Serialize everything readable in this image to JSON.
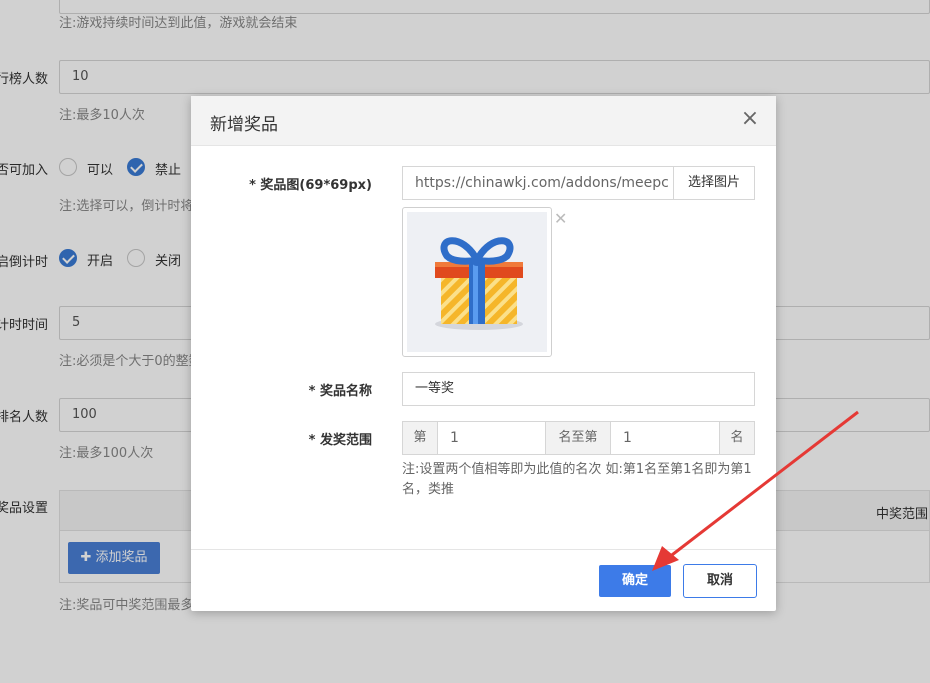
{
  "background_form": {
    "game_duration_hint": "注:游戏持续时间达到此值，游戏就会结束",
    "leaderboard_label": "行榜人数",
    "leaderboard_value": "10",
    "leaderboard_hint": "注:最多10人次",
    "join_label": "否可加入",
    "join_options": [
      "可以",
      "禁止"
    ],
    "join_hint": "注:选择可以，倒计时将",
    "countdown_label": "启倒计时",
    "countdown_options": [
      "开启",
      "关闭"
    ],
    "countdown_time_label": "计时时间",
    "countdown_time_value": "5",
    "countdown_time_hint": "注:必须是个大于0的整数",
    "rank_count_label": "排名人数",
    "rank_count_value": "100",
    "rank_count_hint": "注:最多100人次",
    "prize_settings_label": "奖品设置",
    "table_header_range": "中奖范围",
    "add_prize_label": "添加奖品",
    "prize_hint": "注:奖品可中奖范围最多"
  },
  "modal": {
    "title": "新增奖品",
    "close_icon": "close-icon",
    "image_label": "* 奖品图(69*69px)",
    "image_url": "https://chinawkj.com/addons/meepc",
    "choose_image_label": "选择图片",
    "remove_icon": "remove-x-icon",
    "name_label": "* 奖品名称",
    "name_value": "一等奖",
    "range_label": "* 发奖范围",
    "range_prefix": "第",
    "range_from": "1",
    "range_middle": "名至第",
    "range_to": "1",
    "range_suffix": "名",
    "range_note": "注:设置两个值相等即为此值的名次 如:第1名至第1名即为第1名，类推",
    "ok_label": "确定",
    "cancel_label": "取消"
  },
  "colors": {
    "primary": "#3d7be8",
    "arrow": "#e53935"
  }
}
